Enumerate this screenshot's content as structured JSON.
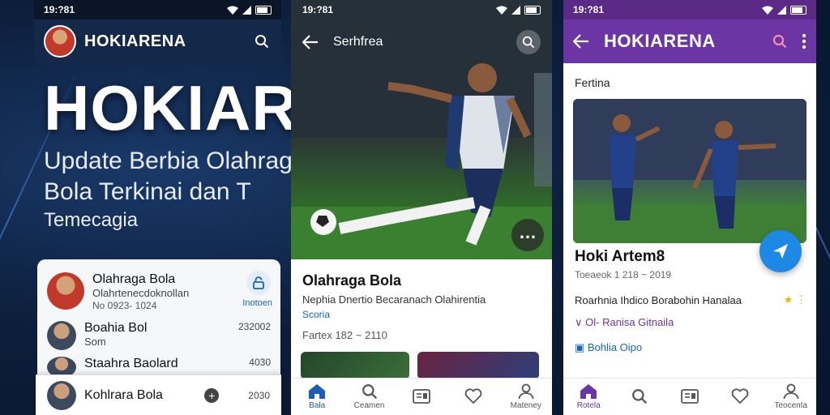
{
  "left_panel": {
    "status_time": "19:?81",
    "app_title": "HOKIARENA",
    "hero_title": "HOKIARENA",
    "hero_subtitle_line1": "Update Berbia Olahragia",
    "hero_subtitle_line2": "Bola Terkinai dan T",
    "hero_subtitle_line3": "Temecagia",
    "list": [
      {
        "title": "Olahraga Bola",
        "subtitle": "Olahrtenecdoknollan",
        "meta": "No 0923- 1024"
      },
      {
        "title": "Boahia Bol",
        "subtitle": "Som",
        "time": "232002"
      },
      {
        "title": "Staahra Baolard",
        "time": "4030"
      }
    ],
    "lock_label": "Inotoen",
    "bottom_item": "Kohlrara Bola",
    "bottom_time": "2030"
  },
  "middle_panel": {
    "status_time": "19:?81",
    "nav_title": "Serhfrea",
    "title": "Olahraga Bola",
    "description": "Nephia Dnertio Becaranach Olahirentia",
    "tag": "Scoria",
    "meta": "Fartex 182 ~ 2110",
    "nav": [
      {
        "label": "Bala",
        "icon": "home-icon"
      },
      {
        "label": "Ceamen",
        "icon": "search-icon"
      },
      {
        "label": "",
        "icon": "news-icon"
      },
      {
        "label": "",
        "icon": "heart-icon"
      },
      {
        "label": "Mateney",
        "icon": "profile-icon"
      }
    ]
  },
  "right_panel": {
    "status_time": "19:?81",
    "app_title": "HOKIARENA",
    "section_label": "Fertina",
    "title": "Hoki Artem8",
    "meta": "Toeaeok 1 218 ~ 2019",
    "description": "Roarhnia Ihdico Borabohin Hanalaa",
    "link1": "Ol- Ranisa Gitnaila",
    "link2": "Bohlia Oipo",
    "nav": [
      {
        "label": "Rotela",
        "icon": "home-icon"
      },
      {
        "label": "",
        "icon": "search-icon"
      },
      {
        "label": "",
        "icon": "news-icon"
      },
      {
        "label": "",
        "icon": "heart-icon"
      },
      {
        "label": "Teocenta",
        "icon": "profile-icon"
      }
    ]
  },
  "colors": {
    "accent_blue": "#1e88e5",
    "purple": "#6b35a3",
    "dark_bg": "#0d1f3d"
  }
}
